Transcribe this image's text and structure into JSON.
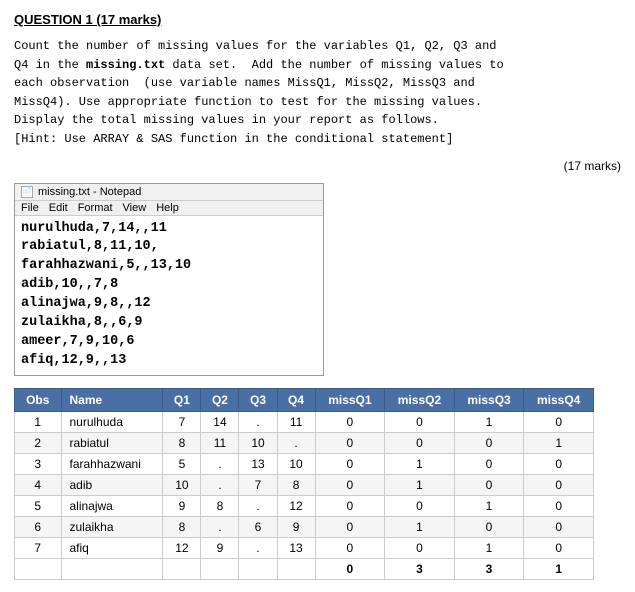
{
  "question": {
    "title": "QUESTION 1 (17 marks)",
    "body_lines": [
      "Count the number of missing values for the variables Q1, Q2, Q3 and",
      "Q4 in the missing.txt data set.  Add the number of missing values to",
      "each observation  (use variable names MissQ1, MissQ2, MissQ3 and",
      "MissQ4). Use appropriate function to test for the missing values.",
      "Display the total missing values in your report as follows.",
      "[Hint: Use ARRAY & SAS function in the conditional statement]"
    ],
    "bold_word": "missing.txt",
    "marks_label": "(17 marks)"
  },
  "notepad": {
    "title": "missing.txt - Notepad",
    "menu_items": [
      "File",
      "Edit",
      "Format",
      "View",
      "Help"
    ],
    "content_lines": [
      "nurulhuda,7,14,,11",
      "rabiatul,8,11,10,",
      "farahhazwani,5,,13,10",
      "adib,10,,7,8",
      "alinajwa,9,8,,12",
      "zulaikha,8,,6,9",
      "ameer,7,9,10,6",
      "afiq,12,9,,13"
    ]
  },
  "table": {
    "headers": [
      "Obs",
      "Name",
      "Q1",
      "Q2",
      "Q3",
      "Q4",
      "missQ1",
      "missQ2",
      "missQ3",
      "missQ4"
    ],
    "rows": [
      {
        "obs": "1",
        "name": "nurulhuda",
        "q1": "7",
        "q2": "14",
        "q3": ".",
        "q4": "11",
        "m1": "0",
        "m2": "0",
        "m3": "1",
        "m4": "0"
      },
      {
        "obs": "2",
        "name": "rabiatul",
        "q1": "8",
        "q2": "11",
        "q3": "10",
        "q4": ".",
        "m1": "0",
        "m2": "0",
        "m3": "0",
        "m4": "1"
      },
      {
        "obs": "3",
        "name": "farahhazwani",
        "q1": "5",
        "q2": ".",
        "q3": "13",
        "q4": "10",
        "m1": "0",
        "m2": "1",
        "m3": "0",
        "m4": "0"
      },
      {
        "obs": "4",
        "name": "adib",
        "q1": "10",
        "q2": ".",
        "q3": "7",
        "q4": "8",
        "m1": "0",
        "m2": "1",
        "m3": "0",
        "m4": "0"
      },
      {
        "obs": "5",
        "name": "alinajwa",
        "q1": "9",
        "q2": "8",
        "q3": ".",
        "q4": "12",
        "m1": "0",
        "m2": "0",
        "m3": "1",
        "m4": "0"
      },
      {
        "obs": "6",
        "name": "zulaikha",
        "q1": "8",
        "q2": ".",
        "q3": "6",
        "q4": "9",
        "m1": "0",
        "m2": "1",
        "m3": "0",
        "m4": "0"
      },
      {
        "obs": "7",
        "name": "afiq",
        "q1": "12",
        "q2": "9",
        "q3": ".",
        "q4": "13",
        "m1": "0",
        "m2": "0",
        "m3": "1",
        "m4": "0"
      }
    ],
    "total_row": {
      "m1": "0",
      "m2": "3",
      "m3": "3",
      "m4": "1"
    }
  }
}
